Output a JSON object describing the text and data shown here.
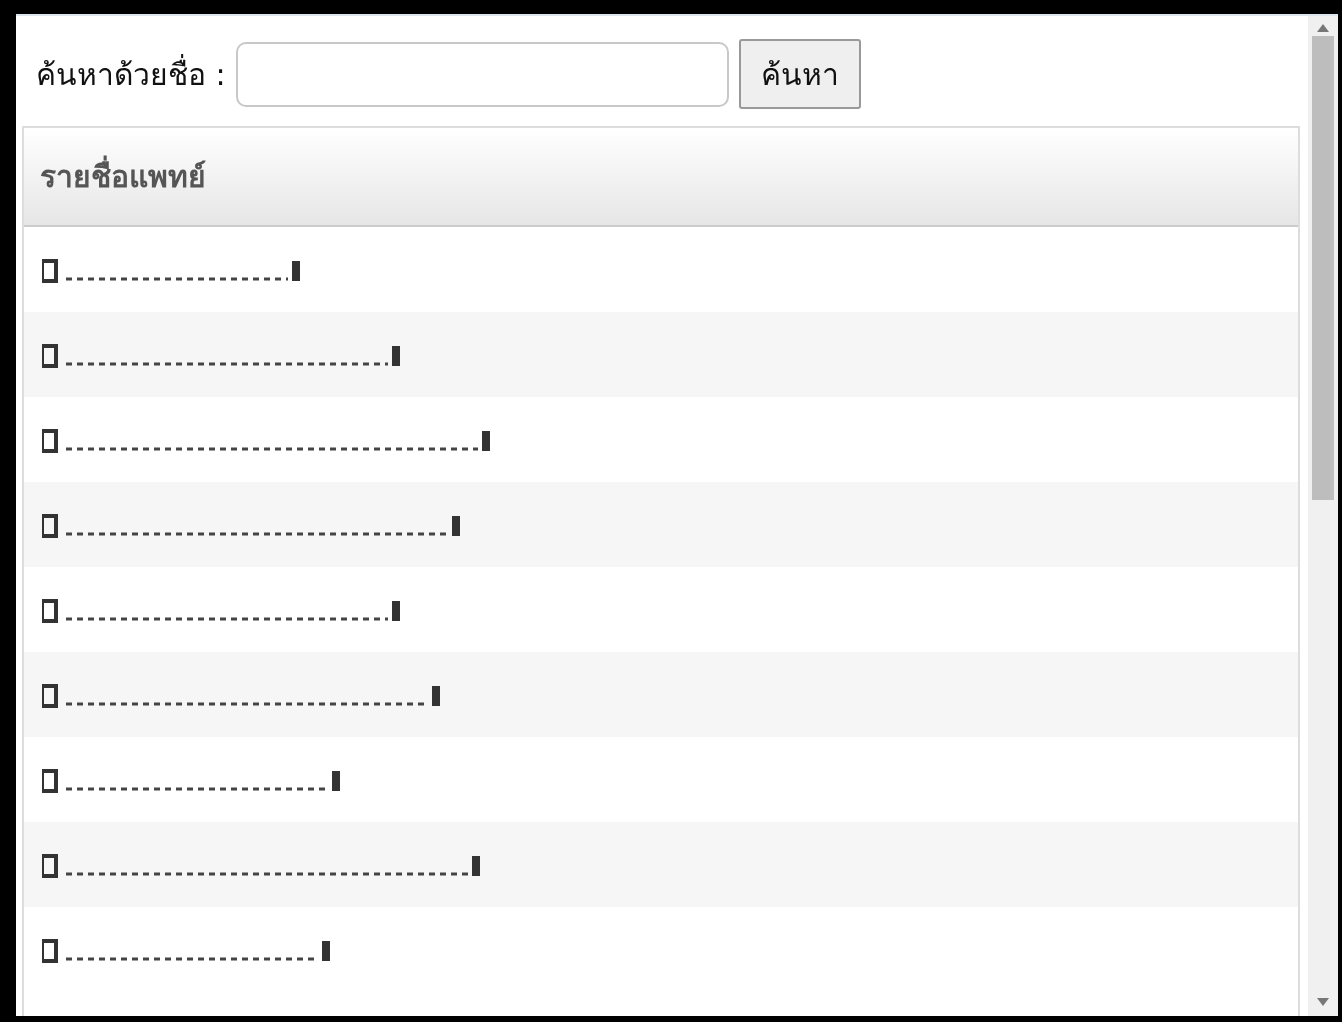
{
  "search": {
    "label": "ค้นหาด้วยชื่อ :",
    "button": "ค้นหา"
  },
  "doctor_list": {
    "heading": "รายชื่อแพทย์",
    "rows": [
      {
        "redacted": true
      },
      {
        "redacted": true
      },
      {
        "redacted": true
      },
      {
        "redacted": true
      },
      {
        "redacted": true
      },
      {
        "redacted": true
      },
      {
        "redacted": true
      },
      {
        "redacted": true
      },
      {
        "redacted": true
      }
    ]
  }
}
